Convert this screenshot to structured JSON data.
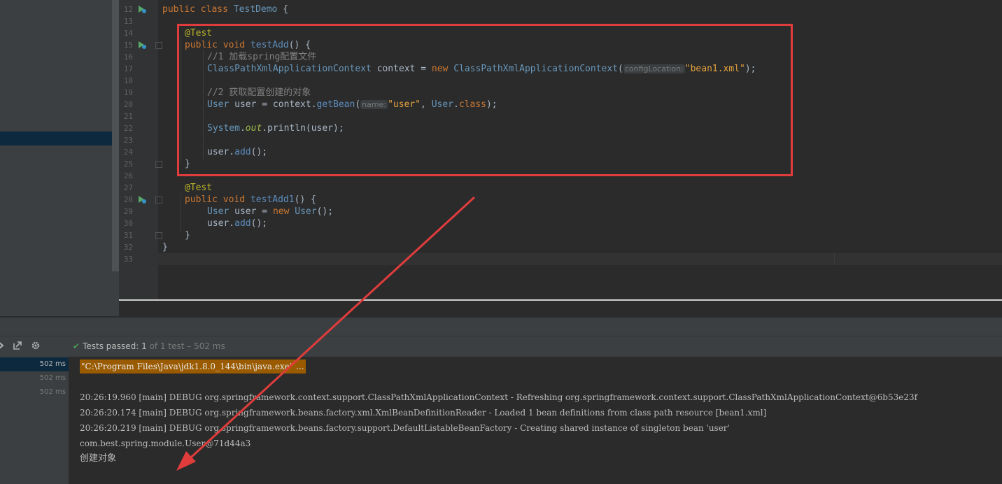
{
  "gutter": {
    "line_numbers": [
      "12",
      "13",
      "14",
      "15",
      "16",
      "17",
      "18",
      "19",
      "20",
      "21",
      "22",
      "23",
      "24",
      "25",
      "26",
      "27",
      "28",
      "29",
      "30",
      "31",
      "32",
      "33"
    ]
  },
  "code": {
    "l12_kw1": "public",
    "l12_kw2": "class",
    "l12_name": "TestDemo",
    "l12_brace": " {",
    "l14_anno": "@Test",
    "l15_kw1": "public",
    "l15_kw2": "void",
    "l15_name": "testAdd",
    "l15_rest": "() {",
    "l16_comment": "//1 加载spring配置文件",
    "l17_type": "ClassPathXmlApplicationContext",
    "l17_var": " context = ",
    "l17_new": "new",
    "l17_ctor": "ClassPathXmlApplicationContext",
    "l17_paren": "(",
    "l17_hint": "configLocation:",
    "l17_str": "\"bean1.xml\"",
    "l17_end": ");",
    "l19_comment": "//2 获取配置创建的对象",
    "l20_type": "User",
    "l20_var": " user = context.",
    "l20_method": "getBean",
    "l20_paren": "(",
    "l20_hint": "name:",
    "l20_str": "\"user\"",
    "l20_comma": ", ",
    "l20_cls": "User",
    "l20_dot": ".",
    "l20_kwclass": "class",
    "l20_end": ");",
    "l22_system": "System",
    "l22_dot": ".",
    "l22_out": "out",
    "l22_println": ".println(user);",
    "l24_user": "user.",
    "l24_add": "add",
    "l24_end": "();",
    "l25_brace": "}",
    "l27_anno": "@Test",
    "l28_kw1": "public",
    "l28_kw2": "void",
    "l28_name": "testAdd1",
    "l28_rest": "() {",
    "l29_type": "User",
    "l29_var": " user = ",
    "l29_new": "new",
    "l29_cls": "User",
    "l29_end": "();",
    "l30_user": "user.",
    "l30_add": "add",
    "l30_end": "();",
    "l31_brace": "}",
    "l32_brace": "}"
  },
  "run_panel": {
    "status_label": "Tests passed:",
    "status_count": "1",
    "status_total": "of 1 test – 502 ms"
  },
  "test_tree": {
    "rows": [
      "502 ms",
      "502 ms",
      "502 ms"
    ]
  },
  "console": {
    "cmd": "\"C:\\Program Files\\Java\\jdk1.8.0_144\\bin\\java.exe\" ...",
    "lines": [
      "20:26:19.960 [main] DEBUG org.springframework.context.support.ClassPathXmlApplicationContext - Refreshing org.springframework.context.support.ClassPathXmlApplicationContext@6b53e23f",
      "20:26:20.174 [main] DEBUG org.springframework.beans.factory.xml.XmlBeanDefinitionReader - Loaded 1 bean definitions from class path resource [bean1.xml]",
      "20:26:20.219 [main] DEBUG org.springframework.beans.factory.support.DefaultListableBeanFactory - Creating shared instance of singleton bean 'user'",
      "com.best.spring.module.User@71d44a3"
    ],
    "output": "创建对象"
  },
  "colors": {
    "highlight_box": "#e03c3c",
    "annotation_arrow": "#e03c3c"
  }
}
